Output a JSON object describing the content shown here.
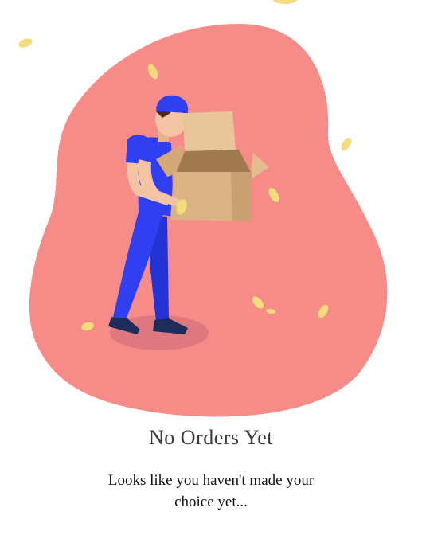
{
  "empty_state": {
    "title": "No Orders Yet",
    "message": "Looks like you haven't made your choice yet..."
  },
  "colors": {
    "blob": "#f78b88",
    "uniform": "#2f3ff2",
    "skin": "#f3c3a3",
    "box": "#dcb184",
    "leaf": "#f3dc7c"
  },
  "illustration": {
    "subject": "delivery-man-opening-empty-box",
    "decorations": "falling-leaves"
  }
}
